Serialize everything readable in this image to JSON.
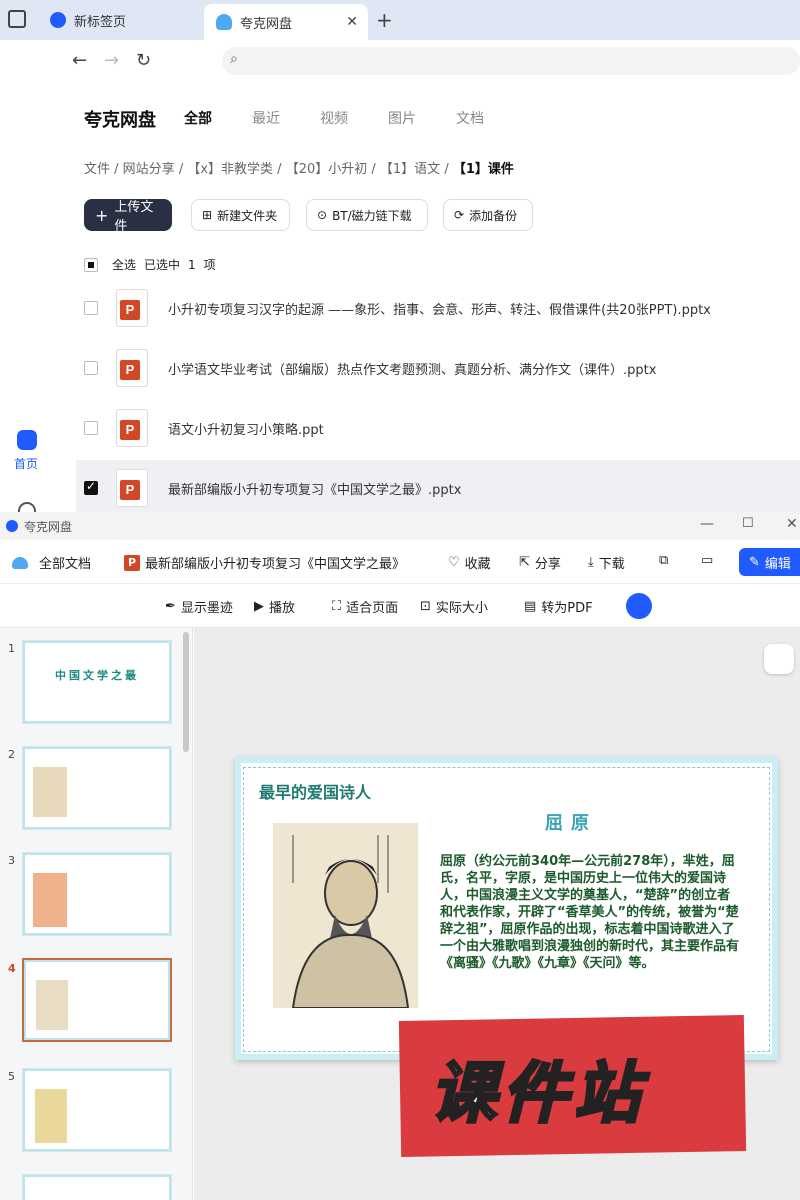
{
  "browser": {
    "tabs": [
      {
        "label": "新标签页"
      },
      {
        "label": "夸克网盘"
      }
    ]
  },
  "drive": {
    "brand": "夸克网盘",
    "nav_tabs": [
      "全部",
      "最近",
      "视频",
      "图片",
      "文档"
    ],
    "rail": {
      "home_label": "首页"
    },
    "breadcrumb": [
      "文件",
      "网站分享",
      "【x】非教学类",
      "【20】小升初",
      "【1】语文",
      "【1】课件"
    ],
    "actions": {
      "upload": "上传文件",
      "new_folder": "新建文件夹",
      "bt": "BT/磁力链下载",
      "backup": "添加备份"
    },
    "selection": {
      "select_all": "全选",
      "selected_prefix": "已选中",
      "count": "1",
      "unit": "项"
    },
    "files": [
      {
        "name": "小升初专项复习汉字的起源 ——象形、指事、会意、形声、转注、假借课件(共20张PPT).pptx",
        "checked": false
      },
      {
        "name": "小学语文毕业考试（部编版）热点作文考题预测、真题分析、满分作文（课件）.pptx",
        "checked": false
      },
      {
        "name": "语文小升初复习小策略.ppt",
        "checked": false
      },
      {
        "name": "最新部编版小升初专项复习《中国文学之最》.pptx",
        "checked": true
      }
    ]
  },
  "viewer": {
    "window_title": "夸克网盘",
    "all_docs": "全部文档",
    "doc_title": "最新部编版小升初专项复习《中国文学之最》",
    "actions": {
      "favorite": "收藏",
      "share": "分享",
      "download": "下载",
      "edit": "编辑"
    },
    "toolbar": {
      "ink": "显示墨迹",
      "play": "播放",
      "fit": "适合页面",
      "actual": "实际大小",
      "pdf": "转为PDF"
    },
    "thumb_numbers": [
      "1",
      "2",
      "3",
      "4",
      "5"
    ],
    "thumb1_title": "中国文学之最",
    "slide": {
      "title": "最早的爱国诗人",
      "name": "屈原",
      "body": "屈原（约公元前340年—公元前278年），芈姓，屈氏，名平，字原，是中国历史上一位伟大的爱国诗人，中国浪漫主义文学的奠基人，“楚辞”的创立者和代表作家，开辟了“香草美人”的传统，被誉为“楚辞之祖”，屈原作品的出现，标志着中国诗歌进入了一个由大雅歌唱到浪漫独创的新时代，其主要作品有《离骚》《九歌》《九章》《天问》等。"
    },
    "watermark": "课件站",
    "colors": {
      "accent": "#1f5bff",
      "slide_title": "#1e7a73",
      "stamp": "#d93b3f"
    }
  }
}
